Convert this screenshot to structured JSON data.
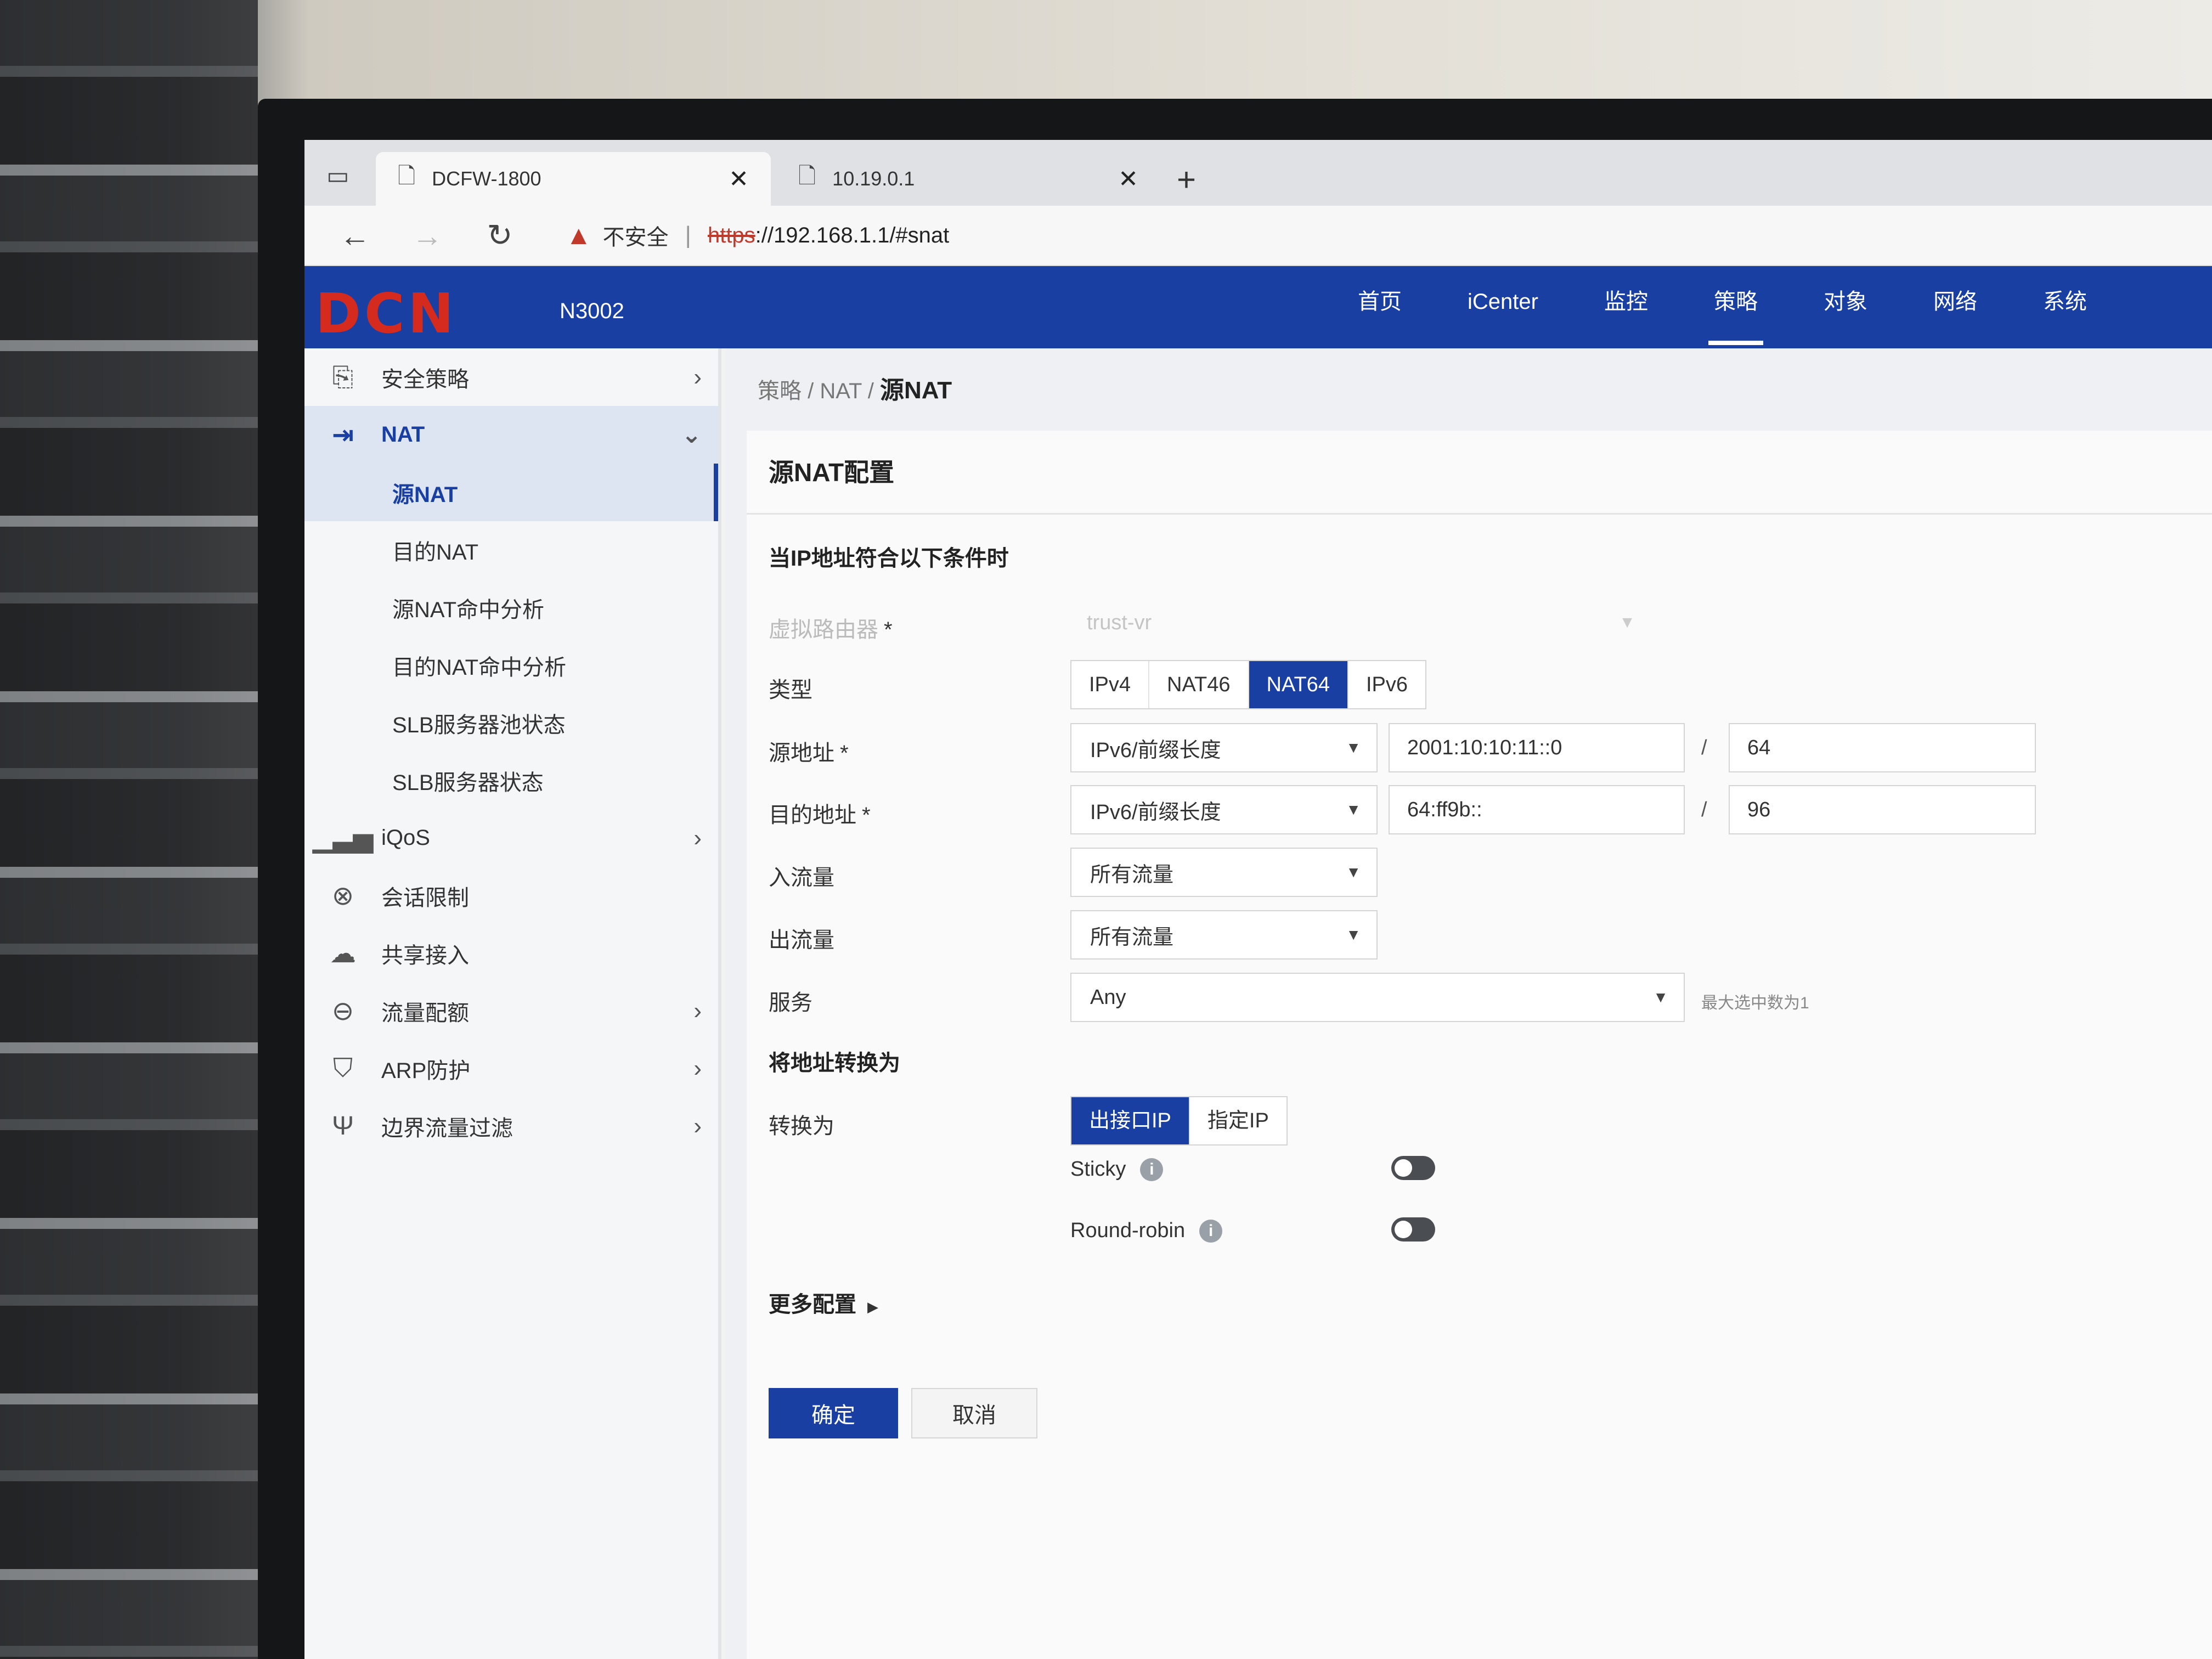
{
  "browser": {
    "tabs": [
      {
        "title": "DCFW-1800",
        "icon": "page-icon",
        "active": true
      },
      {
        "title": "10.19.0.1",
        "icon": "page-icon",
        "active": false
      }
    ],
    "security_label": "不安全",
    "url_scheme": "https",
    "url_rest": "://192.168.1.1/#snat"
  },
  "header": {
    "logo": "DCN",
    "model": "N3002",
    "nav": [
      "首页",
      "iCenter",
      "监控",
      "策略",
      "对象",
      "网络",
      "系统"
    ],
    "active_nav": "策略"
  },
  "sidebar": {
    "items": [
      {
        "label": "安全策略",
        "icon": "policy-icon"
      },
      {
        "label": "NAT",
        "icon": "nat-icon"
      },
      {
        "label": "iQoS",
        "icon": "chart-icon"
      },
      {
        "label": "会话限制",
        "icon": "session-limit-icon"
      },
      {
        "label": "共享接入",
        "icon": "cloud-icon"
      },
      {
        "label": "流量配额",
        "icon": "quota-icon"
      },
      {
        "label": "ARP防护",
        "icon": "shield-icon"
      },
      {
        "label": "边界流量过滤",
        "icon": "filter-icon"
      }
    ],
    "nat_sub": [
      "源NAT",
      "目的NAT",
      "源NAT命中分析",
      "目的NAT命中分析",
      "SLB服务器池状态",
      "SLB服务器状态"
    ]
  },
  "breadcrumb": {
    "part1": "策略",
    "sep": " / ",
    "part2": "NAT",
    "current": "源NAT"
  },
  "form": {
    "title": "源NAT配置",
    "section_match": "当IP地址符合以下条件时",
    "vrouter_label": "虚拟路由器",
    "vrouter_value": "trust-vr",
    "type_label": "类型",
    "type_options": [
      "IPv4",
      "NAT46",
      "NAT64",
      "IPv6"
    ],
    "type_selected": "NAT64",
    "src_label": "源地址",
    "src_mode": "IPv6/前缀长度",
    "src_ip": "2001:10:10:11::0",
    "src_prefix": "64",
    "dst_label": "目的地址",
    "dst_mode": "IPv6/前缀长度",
    "dst_ip": "64:ff9b::",
    "dst_prefix": "96",
    "ingress_label": "入流量",
    "ingress_value": "所有流量",
    "egress_label": "出流量",
    "egress_value": "所有流量",
    "service_label": "服务",
    "service_value": "Any",
    "service_hint": "最大选中数为1",
    "section_translate": "将地址转换为",
    "translate_label": "转换为",
    "translate_options": [
      "出接口IP",
      "指定IP"
    ],
    "translate_selected": "出接口IP",
    "sticky_label": "Sticky",
    "roundrobin_label": "Round-robin",
    "sticky_on": false,
    "roundrobin_on": false,
    "more_config": "更多配置",
    "ok_button": "确定",
    "cancel_button": "取消"
  },
  "colors": {
    "brand_blue": "#1a3fa3",
    "logo_red": "#d52b1e",
    "warning_red": "#c0392b"
  }
}
